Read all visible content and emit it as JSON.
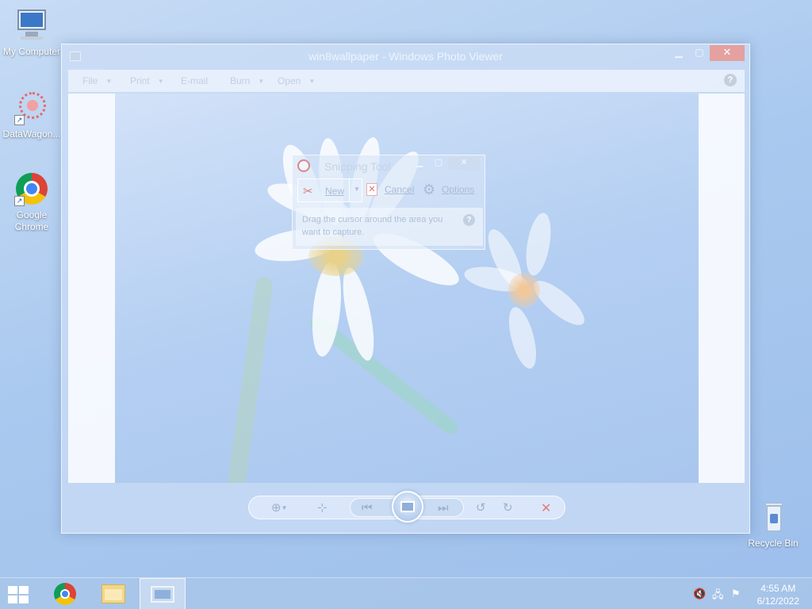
{
  "desktop": {
    "icons": [
      {
        "label": "My Computer"
      },
      {
        "label": "DataWagon..."
      },
      {
        "label": "Google Chrome"
      },
      {
        "label": "Recycle Bin"
      }
    ]
  },
  "photo_viewer": {
    "title": "win8wallpaper - Windows Photo Viewer",
    "menu": {
      "file": "File",
      "print": "Print",
      "email": "E-mail",
      "burn": "Burn",
      "open": "Open"
    },
    "help": "?"
  },
  "snipping_tool": {
    "title": "Snipping Tool",
    "new_label": "New",
    "cancel_label": "Cancel",
    "options_label": "Options",
    "message": "Drag the cursor around the area you want to capture.",
    "help": "?"
  },
  "taskbar": {
    "clock_time": "4:55 AM",
    "clock_date": "6/12/2022"
  },
  "icons": {
    "minimize": "minimize-icon",
    "maximize": "maximize-icon",
    "close": "close-icon"
  },
  "colors": {
    "desktop_bg": "#aac9ef",
    "close_button": "#e5a0a0",
    "delete_red": "#e57b7b"
  }
}
